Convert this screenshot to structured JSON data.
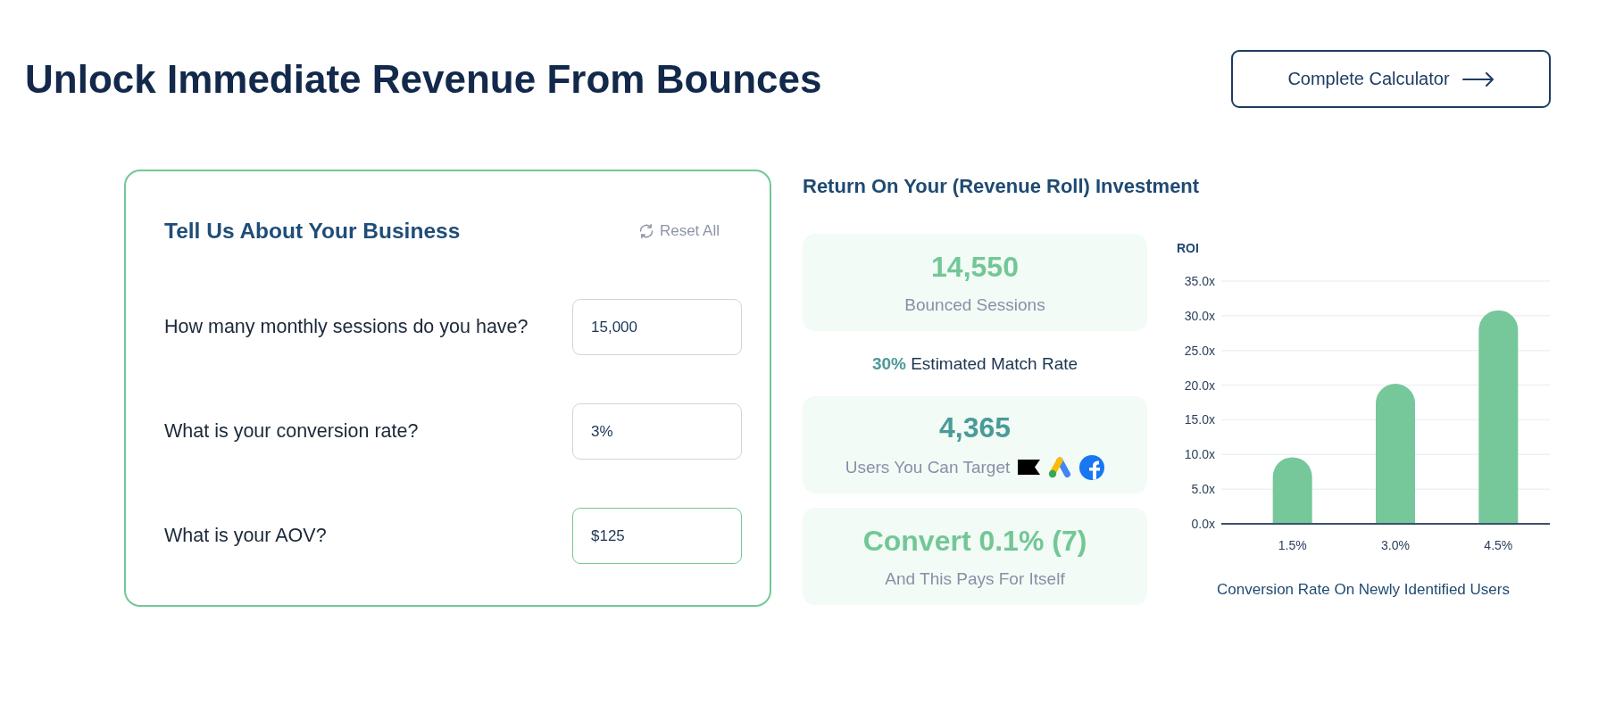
{
  "header": {
    "title": "Unlock Immediate Revenue From Bounces",
    "button": {
      "label": "Complete Calculator"
    }
  },
  "business": {
    "title": "Tell Us About Your Business",
    "reset": {
      "label": "Reset All"
    },
    "fields": [
      {
        "label": "How many monthly sessions do you have?",
        "value": "15,000",
        "focused": false
      },
      {
        "label": "What is your conversion rate?",
        "value": "3%",
        "focused": false
      },
      {
        "label": "What is your AOV?",
        "value": "$125",
        "focused": true
      }
    ]
  },
  "results": {
    "title": "Return On Your (Revenue Roll) Investment",
    "stats": [
      {
        "kind": "plain",
        "value": "14,550",
        "caption": "Bounced Sessions",
        "color": "#72c796"
      },
      {
        "kind": "note",
        "text": "**30%** Estimated Match Rate"
      },
      {
        "kind": "platforms",
        "value": "4,365",
        "caption": "Users You Can Target",
        "color": "#4a9a98"
      },
      {
        "kind": "plain",
        "value": "Convert 0.1% (7)",
        "caption": "And This Pays For Itself",
        "color": "#72c796"
      }
    ]
  },
  "chart": {
    "chart_data": {
      "type": "bar",
      "ylabel": "ROI",
      "xlabel": "Conversion Rate On Newly Identified Users",
      "categories": [
        "1.5%",
        "3.0%",
        "4.5%"
      ],
      "values": [
        9.6,
        20.2,
        30.8
      ],
      "ylim": [
        0,
        35
      ],
      "grid": true,
      "yticks": [
        {
          "value": 0,
          "label": "0.0x"
        },
        {
          "value": 5,
          "label": "5.0x"
        },
        {
          "value": 10,
          "label": "10.0x"
        },
        {
          "value": 15,
          "label": "15.0x"
        },
        {
          "value": 20,
          "label": "20.0x"
        },
        {
          "value": 25,
          "label": "25.0x"
        },
        {
          "value": 30,
          "label": "30.0x"
        },
        {
          "value": 35,
          "label": "35.0x"
        }
      ]
    }
  }
}
